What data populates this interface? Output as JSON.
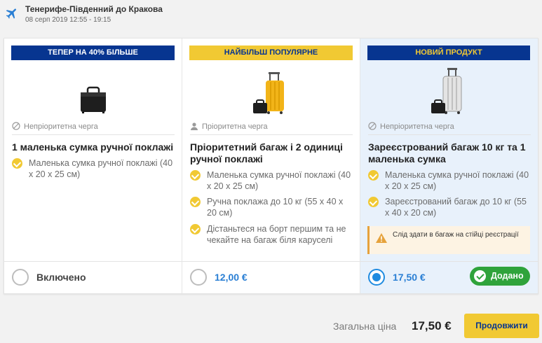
{
  "flight": {
    "route": "Тенерифе-Південний до Кракова",
    "date": "08 серп 2019  12:55 - 19:15"
  },
  "icons": {
    "plane": "plane-icon",
    "no_priority": "no-priority-icon",
    "person": "person-icon",
    "check": "check-icon",
    "warning": "warning-icon"
  },
  "colors": {
    "navy": "#073590",
    "yellow": "#f1c933",
    "green": "#2fa33b",
    "blue": "#2a7fd4",
    "selected_bg": "#e8f1fb"
  },
  "cards": [
    {
      "banner": "ТЕПЕР НА 40% БІЛЬШЕ",
      "queue": "Непріоритетна черга",
      "title": "1 маленька сумка ручної поклажі",
      "features": [
        "Маленька сумка ручної поклажі (40 x 20 x 25 см)"
      ],
      "price": "Включено",
      "selected": false
    },
    {
      "banner": "НАЙБІЛЬШ ПОПУЛЯРНЕ",
      "queue": "Пріоритетна черга",
      "title": "Пріоритетний багаж і 2 одиниці ручної поклажі",
      "features": [
        "Маленька сумка ручної поклажі (40 x 20 x 25 см)",
        "Ручна поклажа до 10 кг (55 x 40 x 20 см)",
        "Дістаньтеся на борт першим та не чекайте на багаж біля каруселі"
      ],
      "price": "12,00 €",
      "selected": false
    },
    {
      "banner": "НОВИЙ ПРОДУКТ",
      "queue": "Непріоритетна черга",
      "title": "Зареєстрований багаж 10 кг та 1 маленька сумка",
      "features": [
        "Маленька сумка ручної поклажі (40 x 20 x 25 см)",
        "Зареєстрований багаж до 10 кг (55 x 40 x 20 см)"
      ],
      "warning": "Слід здати в багаж на стійці реєстрації",
      "price": "17,50 €",
      "added_label": "Додано",
      "selected": true
    }
  ],
  "footer": {
    "total_label": "Загальна ціна",
    "total_value": "17,50 €",
    "continue_label": "Продовжити"
  }
}
